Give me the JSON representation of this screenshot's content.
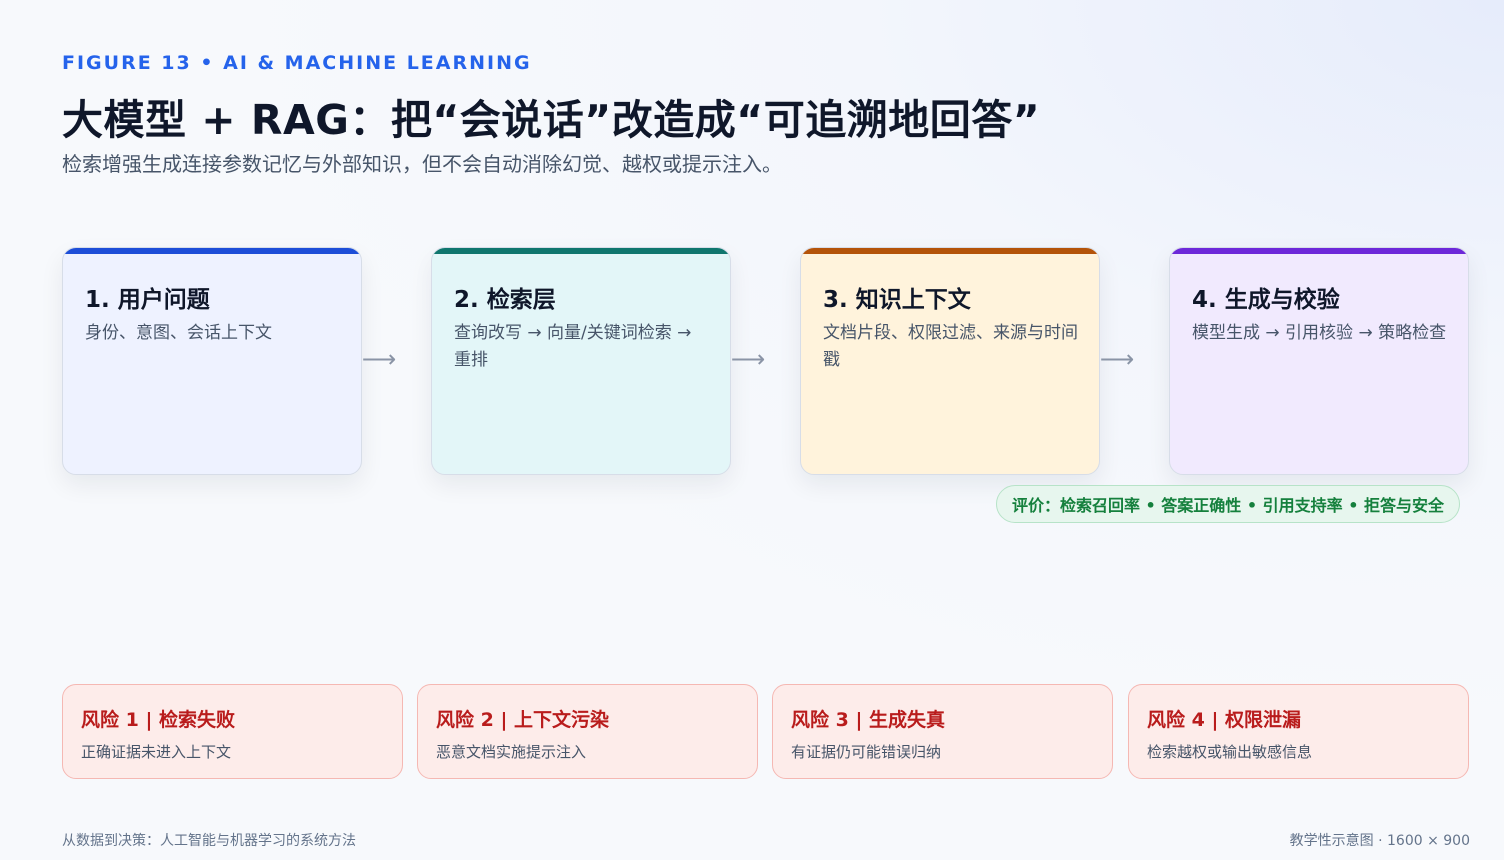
{
  "header": {
    "kicker": "FIGURE 13 • AI & MACHINE LEARNING",
    "title": "大模型 + RAG：把“会说话”改造成“可追溯地回答”",
    "subtitle": "检索增强生成连接参数记忆与外部知识，但不会自动消除幻觉、越权或提示注入。"
  },
  "steps": [
    {
      "title": "1. 用户问题",
      "desc": "身份、意图、会话上下文",
      "accent": "#1d4ed8",
      "bg": "#eef2ff"
    },
    {
      "title": "2. 检索层",
      "desc": "查询改写 → 向量/关键词检索 → 重排",
      "accent": "#0f766e",
      "bg": "#e3f6f8"
    },
    {
      "title": "3. 知识上下文",
      "desc": "文档片段、权限过滤、来源与时间戳",
      "accent": "#b45309",
      "bg": "#fff3dc"
    },
    {
      "title": "4. 生成与校验",
      "desc": "模型生成 → 引用核验 → 策略检查",
      "accent": "#6d28d9",
      "bg": "#f1eafe"
    }
  ],
  "arrow_glyph": "⟶",
  "evaluation": "评价：检索召回率 • 答案正确性 • 引用支持率 • 拒答与安全",
  "risks": [
    {
      "title": "风险 1 | 检索失败",
      "desc": "正确证据未进入上下文"
    },
    {
      "title": "风险 2 | 上下文污染",
      "desc": "恶意文档实施提示注入"
    },
    {
      "title": "风险 3 | 生成失真",
      "desc": "有证据仍可能错误归纳"
    },
    {
      "title": "风险 4 | 权限泄漏",
      "desc": "检索越权或输出敏感信息"
    }
  ],
  "footer": {
    "left": "从数据到决策：人工智能与机器学习的系统方法",
    "right": "教学性示意图 · 1600 × 900"
  }
}
